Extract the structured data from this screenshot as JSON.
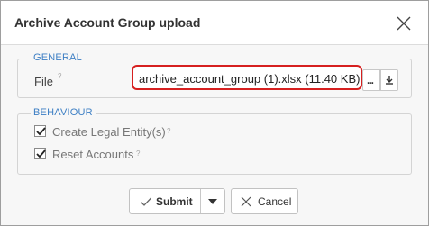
{
  "dialog": {
    "title": "Archive Account Group upload",
    "close_icon": "close-icon"
  },
  "general": {
    "legend": "GENERAL",
    "file_label": "File",
    "help_mark": "?",
    "file_value": "archive_account_group (1).xlsx (11.40 KB)",
    "browse_label": "...",
    "download_icon": "download-icon",
    "highlight_color": "#d62020"
  },
  "behaviour": {
    "legend": "BEHAVIOUR",
    "options": [
      {
        "label": "Create Legal Entity(s)",
        "checked": true,
        "help_mark": "?"
      },
      {
        "label": "Reset Accounts",
        "checked": true,
        "help_mark": "?"
      }
    ]
  },
  "footer": {
    "submit_label": "Submit",
    "submit_icon": "check-icon",
    "dropdown_icon": "caret-down-icon",
    "cancel_label": "Cancel",
    "cancel_icon": "close-icon"
  },
  "colors": {
    "accent": "#3d7fc4",
    "panel_bg": "#f7f7f7"
  }
}
